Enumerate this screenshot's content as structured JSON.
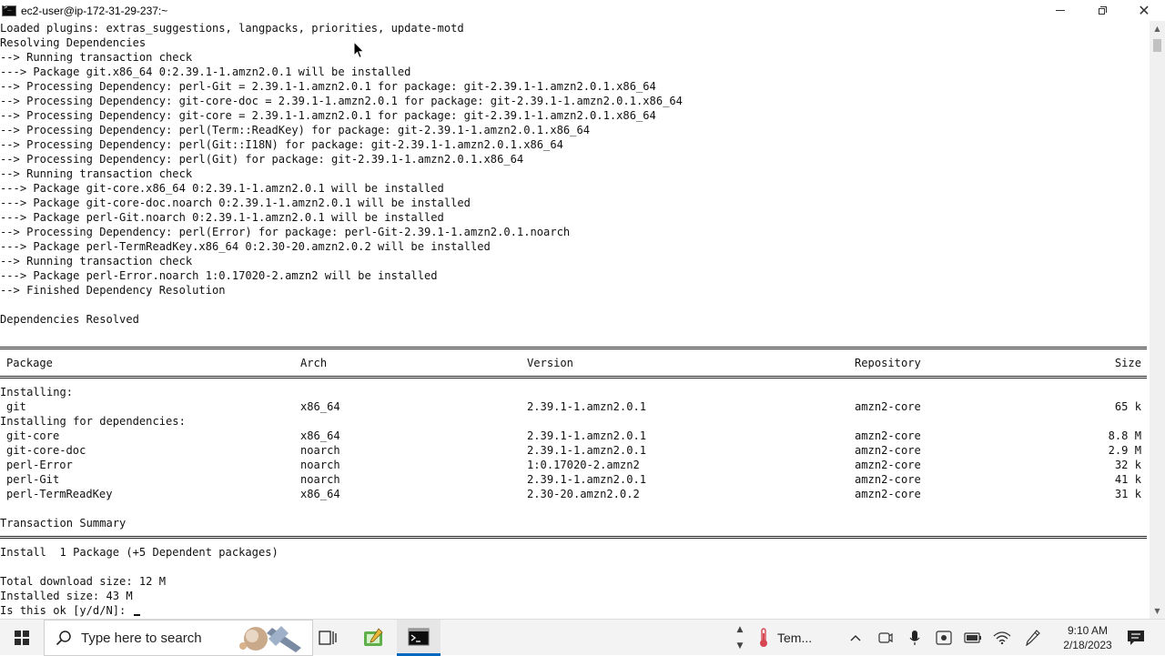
{
  "window": {
    "title": "ec2-user@ip-172-31-29-237:~",
    "icon": "terminal-icon"
  },
  "terminal": {
    "lines_top": [
      "Loaded plugins: extras_suggestions, langpacks, priorities, update-motd",
      "Resolving Dependencies",
      "--> Running transaction check",
      "---> Package git.x86_64 0:2.39.1-1.amzn2.0.1 will be installed",
      "--> Processing Dependency: perl-Git = 2.39.1-1.amzn2.0.1 for package: git-2.39.1-1.amzn2.0.1.x86_64",
      "--> Processing Dependency: git-core-doc = 2.39.1-1.amzn2.0.1 for package: git-2.39.1-1.amzn2.0.1.x86_64",
      "--> Processing Dependency: git-core = 2.39.1-1.amzn2.0.1 for package: git-2.39.1-1.amzn2.0.1.x86_64",
      "--> Processing Dependency: perl(Term::ReadKey) for package: git-2.39.1-1.amzn2.0.1.x86_64",
      "--> Processing Dependency: perl(Git::I18N) for package: git-2.39.1-1.amzn2.0.1.x86_64",
      "--> Processing Dependency: perl(Git) for package: git-2.39.1-1.amzn2.0.1.x86_64",
      "--> Running transaction check",
      "---> Package git-core.x86_64 0:2.39.1-1.amzn2.0.1 will be installed",
      "---> Package git-core-doc.noarch 0:2.39.1-1.amzn2.0.1 will be installed",
      "---> Package perl-Git.noarch 0:2.39.1-1.amzn2.0.1 will be installed",
      "--> Processing Dependency: perl(Error) for package: perl-Git-2.39.1-1.amzn2.0.1.noarch",
      "---> Package perl-TermReadKey.x86_64 0:2.30-20.amzn2.0.2 will be installed",
      "--> Running transaction check",
      "---> Package perl-Error.noarch 1:0.17020-2.amzn2 will be installed",
      "--> Finished Dependency Resolution",
      "",
      "Dependencies Resolved",
      ""
    ],
    "table": {
      "headers": {
        "package": "Package",
        "arch": "Arch",
        "version": "Version",
        "repository": "Repository",
        "size": "Size"
      },
      "installing_label": "Installing:",
      "installing": [
        {
          "package": "git",
          "arch": "x86_64",
          "version": "2.39.1-1.amzn2.0.1",
          "repository": "amzn2-core",
          "size": "65 k"
        }
      ],
      "deps_label": "Installing for dependencies:",
      "deps": [
        {
          "package": "git-core",
          "arch": "x86_64",
          "version": "2.39.1-1.amzn2.0.1",
          "repository": "amzn2-core",
          "size": "8.8 M"
        },
        {
          "package": "git-core-doc",
          "arch": "noarch",
          "version": "2.39.1-1.amzn2.0.1",
          "repository": "amzn2-core",
          "size": "2.9 M"
        },
        {
          "package": "perl-Error",
          "arch": "noarch",
          "version": "1:0.17020-2.amzn2",
          "repository": "amzn2-core",
          "size": "32 k"
        },
        {
          "package": "perl-Git",
          "arch": "noarch",
          "version": "2.39.1-1.amzn2.0.1",
          "repository": "amzn2-core",
          "size": "41 k"
        },
        {
          "package": "perl-TermReadKey",
          "arch": "x86_64",
          "version": "2.30-20.amzn2.0.2",
          "repository": "amzn2-core",
          "size": "31 k"
        }
      ]
    },
    "summary_title": "Transaction Summary",
    "summary_line": "Install  1 Package (+5 Dependent packages)",
    "download_size": "Total download size: 12 M",
    "installed_size": "Installed size: 43 M",
    "prompt": "Is this ok [y/d/N]: "
  },
  "taskbar": {
    "search_placeholder": "Type here to search",
    "weather_text": "Tem...",
    "time": "9:10 AM",
    "date": "2/18/2023"
  },
  "colors": {
    "terminal_bg": "#ffffff",
    "terminal_fg": "#111111",
    "taskbar_bg": "#f3f3f3",
    "accent": "#0067c0"
  }
}
